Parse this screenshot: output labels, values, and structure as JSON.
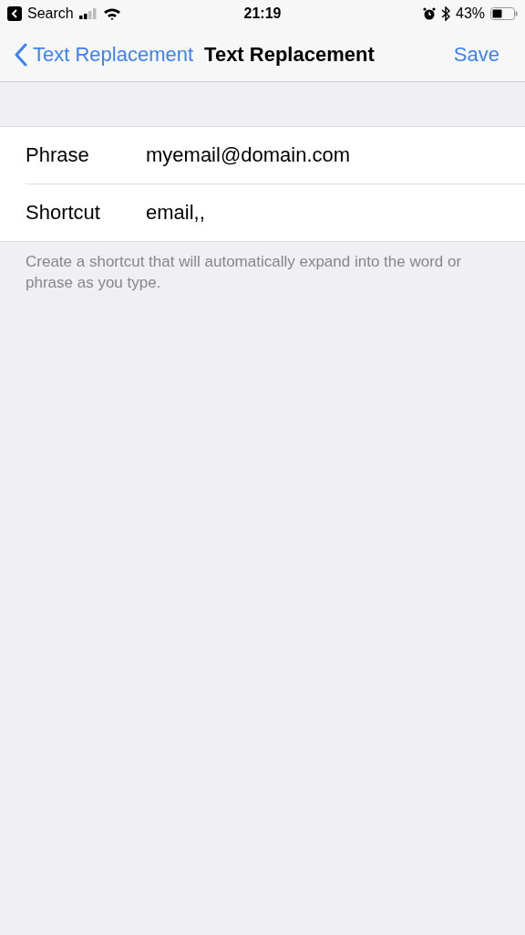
{
  "status_bar": {
    "back_app": "Search",
    "time": "21:19",
    "battery": "43%"
  },
  "nav_bar": {
    "back": "Text Replacement",
    "title": "Text Replacement",
    "action": "Save"
  },
  "fields": [
    {
      "label": "Phrase",
      "value": "myemail@domain.com"
    },
    {
      "label": "Shortcut",
      "value": "email,,"
    }
  ],
  "footer": "Create a shortcut that will automatically expand into the word or phrase as you type."
}
